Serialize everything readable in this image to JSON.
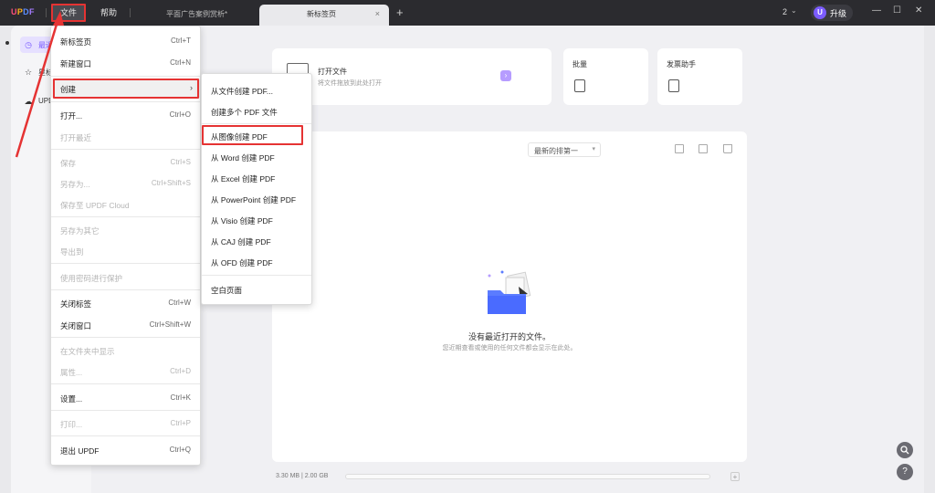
{
  "app": {
    "logo": "UPDF",
    "menu": {
      "file": "文件",
      "help": "帮助"
    },
    "tabs": [
      {
        "label": "平面广告案例赏析*",
        "active": false
      },
      {
        "label": "新标签页",
        "active": true
      }
    ],
    "tab_close": "×",
    "new_tab": "+",
    "count": "2",
    "upgrade_badge": "U",
    "upgrade_label": "升级",
    "window_controls": {
      "minimize": "—",
      "maximize": "☐",
      "close": "✕"
    }
  },
  "sidebar": {
    "items": [
      {
        "label": "最近",
        "icon": "clock-icon",
        "active": true
      },
      {
        "label": "星标",
        "icon": "star-icon",
        "active": false
      },
      {
        "label": "UPDF",
        "icon": "cloud-icon",
        "active": false
      }
    ]
  },
  "main": {
    "open_file": {
      "title": "打开文件",
      "subtitle": "将文件拖放到此处打开",
      "arrow": "›"
    },
    "batch": {
      "title": "批量"
    },
    "invoice": {
      "title": "发票助手"
    },
    "sort": {
      "value": "最新的排第一",
      "chevron": "▾"
    },
    "empty_title": "没有最近打开的文件。",
    "empty_subtitle": "您近期查看或使用的任何文件都会显示在此处。",
    "storage": "3.30 MB | 2.00 GB",
    "storage_add": "+",
    "search_btn": "🔍",
    "help_btn": "?"
  },
  "file_menu": {
    "items": [
      {
        "label": "新标签页",
        "shortcut": "Ctrl+T",
        "disabled": false
      },
      {
        "label": "新建窗口",
        "shortcut": "Ctrl+N",
        "disabled": false
      },
      {
        "label": "创建",
        "shortcut": "",
        "disabled": false,
        "submenu": true
      },
      {
        "label": "打开...",
        "shortcut": "Ctrl+O",
        "disabled": false
      },
      {
        "label": "打开最近",
        "shortcut": "",
        "disabled": true
      },
      {
        "label": "保存",
        "shortcut": "Ctrl+S",
        "disabled": true
      },
      {
        "label": "另存为...",
        "shortcut": "Ctrl+Shift+S",
        "disabled": true
      },
      {
        "label": "保存至 UPDF Cloud",
        "shortcut": "",
        "disabled": true
      },
      {
        "label": "另存为其它",
        "shortcut": "",
        "disabled": true
      },
      {
        "label": "导出到",
        "shortcut": "",
        "disabled": true
      },
      {
        "label": "使用密码进行保护",
        "shortcut": "",
        "disabled": true
      },
      {
        "label": "关闭标签",
        "shortcut": "Ctrl+W",
        "disabled": false
      },
      {
        "label": "关闭窗口",
        "shortcut": "Ctrl+Shift+W",
        "disabled": false
      },
      {
        "label": "在文件夹中显示",
        "shortcut": "",
        "disabled": true
      },
      {
        "label": "属性...",
        "shortcut": "Ctrl+D",
        "disabled": true
      },
      {
        "label": "设置...",
        "shortcut": "Ctrl+K",
        "disabled": false
      },
      {
        "label": "打印...",
        "shortcut": "Ctrl+P",
        "disabled": true
      },
      {
        "label": "退出 UPDF",
        "shortcut": "Ctrl+Q",
        "disabled": false
      }
    ]
  },
  "create_menu": {
    "items": [
      {
        "label": "从文件创建 PDF..."
      },
      {
        "label": "创建多个 PDF 文件"
      },
      {
        "label": "从图像创建 PDF"
      },
      {
        "label": "从 Word 创建 PDF"
      },
      {
        "label": "从 Excel 创建 PDF"
      },
      {
        "label": "从 PowerPoint 创建 PDF"
      },
      {
        "label": "从 Visio 创建 PDF"
      },
      {
        "label": "从 CAJ 创建 PDF"
      },
      {
        "label": "从 OFD 创建 PDF"
      },
      {
        "label": "空白页面"
      }
    ]
  },
  "colors": {
    "accent": "#7b5cff",
    "highlight": "#e53333",
    "titlebar": "#2b2b2f"
  }
}
